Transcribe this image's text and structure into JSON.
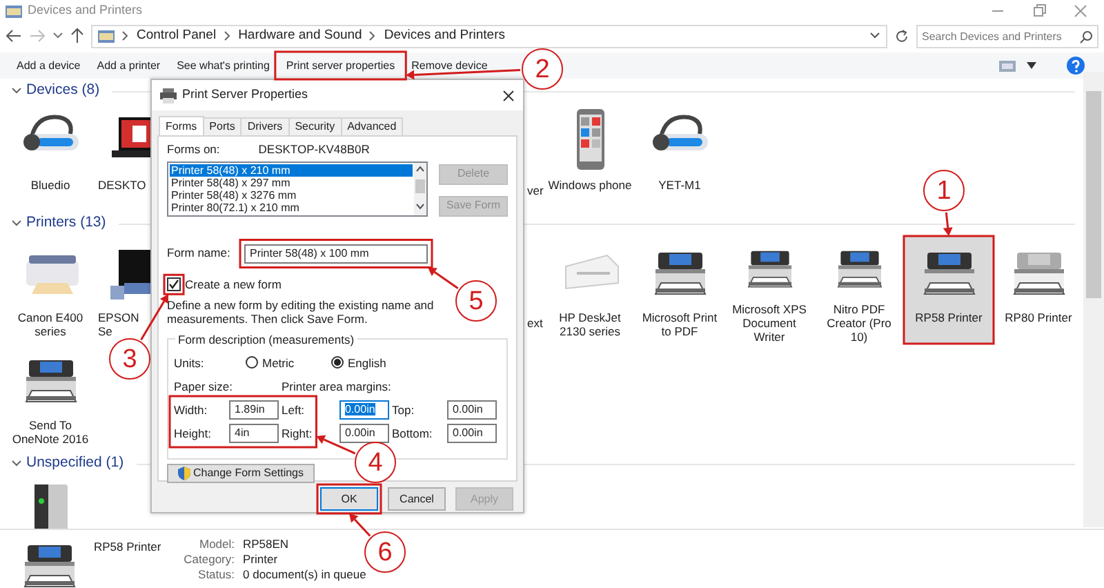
{
  "window": {
    "title": "Devices and Printers"
  },
  "address_bar": {
    "path": [
      "Control Panel",
      "Hardware and Sound",
      "Devices and Printers"
    ]
  },
  "search": {
    "placeholder": "Search Devices and Printers"
  },
  "toolbar": [
    "Add a device",
    "Add a printer",
    "See what's printing",
    "Print server properties",
    "Remove device"
  ],
  "groups": [
    {
      "title": "Devices (8)",
      "expanded": true,
      "items": [
        {
          "label": "Bluedio",
          "kind": "headset",
          "selected": false
        },
        {
          "label": "DESKTO",
          "kind": "laptop",
          "selected": false
        },
        {
          "label": "ver",
          "kind": "partial",
          "selected": false
        },
        {
          "label": "Windows phone",
          "kind": "phone",
          "selected": false
        },
        {
          "label": "YET-M1",
          "kind": "headset",
          "selected": false
        }
      ]
    },
    {
      "title": "Printers (13)",
      "expanded": true,
      "items": [
        {
          "label": "Canon E400 series",
          "kind": "photo-printer",
          "selected": false
        },
        {
          "label": "EPSON\nSe",
          "kind": "inkjet",
          "selected": false
        },
        {
          "label": "ext",
          "kind": "partial",
          "selected": false
        },
        {
          "label": "HP DeskJet 2130 series",
          "kind": "flat-printer",
          "selected": false
        },
        {
          "label": "Microsoft Print to PDF",
          "kind": "printer",
          "selected": false
        },
        {
          "label": "Microsoft XPS Document Writer",
          "kind": "printer",
          "selected": false
        },
        {
          "label": "Nitro PDF Creator (Pro 10)",
          "kind": "printer",
          "selected": false
        },
        {
          "label": "RP58 Printer",
          "kind": "printer",
          "selected": true
        },
        {
          "label": "RP80 Printer",
          "kind": "light-printer",
          "selected": false
        },
        {
          "label": "Send To OneNote 2016",
          "kind": "printer",
          "selected": false
        }
      ]
    },
    {
      "title": "Unspecified (1)",
      "expanded": true,
      "items": [
        {
          "kind": "server",
          "selected": false
        }
      ]
    }
  ],
  "details": {
    "name": "RP58 Printer",
    "fields": [
      {
        "label": "Model:",
        "value": "RP58EN"
      },
      {
        "label": "Category:",
        "value": "Printer"
      },
      {
        "label": "Status:",
        "value": "0 document(s) in queue"
      }
    ]
  },
  "dialog": {
    "title": "Print Server Properties",
    "tabs": [
      {
        "label": "Forms",
        "selected": true
      },
      {
        "label": "Ports",
        "selected": false
      },
      {
        "label": "Drivers",
        "selected": false
      },
      {
        "label": "Security",
        "selected": false
      },
      {
        "label": "Advanced",
        "selected": false
      }
    ],
    "forms_on": {
      "label": "Forms on:",
      "value": "DESKTOP-KV48B0R"
    },
    "forms": [
      {
        "label": "Printer 58(48) x 210 mm",
        "selected": true
      },
      {
        "label": "Printer 58(48) x 297 mm",
        "selected": false
      },
      {
        "label": "Printer 58(48) x 3276 mm",
        "selected": false
      },
      {
        "label": "Printer 80(72.1) x 210 mm",
        "selected": false
      }
    ],
    "side_buttons": [
      {
        "label": "Delete",
        "disabled": true
      },
      {
        "label": "Save Form",
        "disabled": true
      }
    ],
    "form_name": {
      "label": "Form name:",
      "value": "Printer 58(48) x 100 mm"
    },
    "create_new": {
      "label": "Create a new form",
      "checked": true
    },
    "hint": "Define a new form by editing the existing name and measurements. Then click Save Form.",
    "description": {
      "title": "Form description (measurements)",
      "units_label": "Units:",
      "units": [
        {
          "label": "Metric",
          "selected": false
        },
        {
          "label": "English",
          "selected": true
        }
      ],
      "paper_size_label": "Paper size:",
      "margins_label": "Printer area margins:",
      "rows": [
        [
          {
            "label": "Width:",
            "value": "1.89in",
            "selected": false
          },
          {
            "label": "Left:",
            "value": "0.00in",
            "selected": true
          },
          {
            "label": "Top:",
            "value": "0.00in",
            "selected": false
          }
        ],
        [
          {
            "label": "Height:",
            "value": "4in",
            "selected": false
          },
          {
            "label": "Right:",
            "value": "0.00in",
            "selected": false
          },
          {
            "label": "Bottom:",
            "value": "0.00in",
            "selected": false
          }
        ]
      ]
    },
    "change_settings": "Change Form Settings",
    "buttons": [
      {
        "label": "OK",
        "disabled": false
      },
      {
        "label": "Cancel",
        "disabled": false
      },
      {
        "label": "Apply",
        "disabled": true
      }
    ]
  },
  "annotations": [
    {
      "number": "1"
    },
    {
      "number": "2"
    },
    {
      "number": "3"
    },
    {
      "number": "4"
    },
    {
      "number": "5"
    },
    {
      "number": "6"
    }
  ]
}
